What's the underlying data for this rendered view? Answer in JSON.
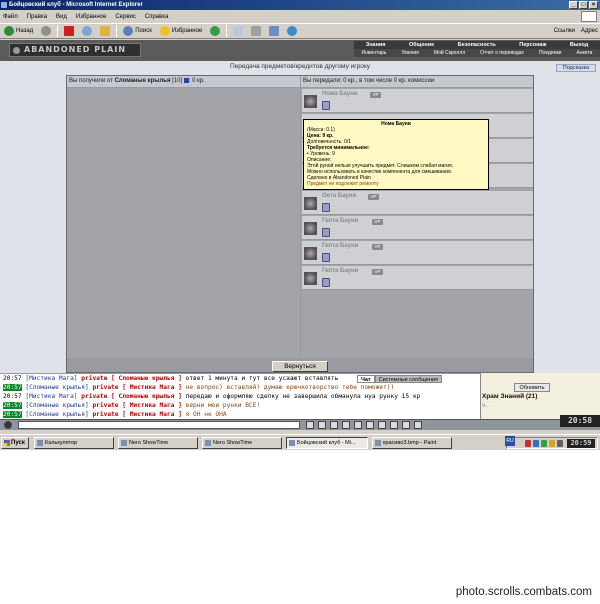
{
  "window": {
    "title": "Бойцовский клуб - Microsoft Internet Explorer"
  },
  "menu": [
    "Файл",
    "Правка",
    "Вид",
    "Избранное",
    "Сервис",
    "Справка"
  ],
  "toolbar": {
    "back": "Назад",
    "search": "Поиск",
    "favorites": "Избранное",
    "links": "Ссылки",
    "address": "Адрес"
  },
  "game": {
    "logo": "ABANDONED PLAIN",
    "nav_top": [
      "Знания",
      "Общение",
      "Безопасность",
      "Персонаж",
      "Выход"
    ],
    "nav_bottom": [
      "Инвентарь",
      "Умения",
      "Мой Скроллл",
      "Отчет о переводах",
      "Поединки",
      "Анкета"
    ],
    "help": "Подсказка",
    "page_title": "Передача предметов/кредитов другому игроку",
    "left_header_prefix": "Вы получили от ",
    "left_header_user": "Сломаные крылья",
    "left_header_level": " [10] ",
    "left_header_suffix": ": 0 кр.",
    "right_header": "Вы передали: 0 кр., в том числе 0 кр. комиссии",
    "return_button": "Вернуться",
    "badge": "VP",
    "items": [
      "Нома Бауни",
      "",
      "",
      "",
      "Оета Бауни",
      "Гепта Бауни",
      "Гепта Бауни",
      "Гепта Бауни"
    ]
  },
  "tooltip": {
    "title": "Нома Бауни",
    "mass": "(Масса: 0.1)",
    "price_label": "Цена:",
    "price": "9 кр.",
    "durability": "Долговечность: 0/1",
    "req_title": "Требуется минимальное:",
    "req_level": "• Уровень: 9",
    "desc_title": "Описание:",
    "desc1": "Этой руной нельзя улучшить предмет. Слишком слабая магия.",
    "desc2": "Можно использовать в качестве компонента для смешивания.",
    "made": "Сделано в Abandoned Plain",
    "repair": "Предмет не подлежит ремонту"
  },
  "chat": {
    "tabs": [
      "Чат",
      "Системные сообщения"
    ],
    "lines": [
      {
        "time": "20:57",
        "user": "[Мистика Мага]",
        "priv": "private [ Сломаные крылья ]",
        "text": "ответ 1 минута и тут все усаают вставлять",
        "hl": false,
        "brown": false
      },
      {
        "time": "20:57",
        "user": "[Сломаные крылья]",
        "priv": "private [ Мистика Мага ]",
        "text": "не вопрос) вставляй) думаю крючкотворство тебе поможет))",
        "hl": true,
        "brown": true
      },
      {
        "time": "20:57",
        "user": "[Мистика Мага]",
        "priv": "private [ Сломаные крылья ]",
        "text": "передаю и оформляю сделку не завершила обманула нуа рунку 15 кр",
        "hl": false,
        "brown": false
      },
      {
        "time": "20:57",
        "user": "[Сломаные крылья]",
        "priv": "private [ Мистика Мага ]",
        "text": "верни мои рунки ВСЕ!",
        "hl": true,
        "brown": true
      },
      {
        "time": "20:57",
        "user": "[Сломаные крылья]",
        "priv": "private [ Мистика Мага ]",
        "text": "я ОН не ОНА",
        "hl": true,
        "brown": true
      }
    ],
    "refresh": "Обновить",
    "room": "Храм Знаний (21)",
    "room_sub": "Ч...",
    "clock": "20:58"
  },
  "taskbar": {
    "start": "Пуск",
    "tasks": [
      "Калькулятор",
      "Nero ShowTime",
      "Nero ShowTime",
      "Бойцовский клуб - Mi...",
      "красивоЗ.bmp - Paint"
    ],
    "lang": "RU",
    "clock": "20:59"
  },
  "footer": "photo.scrolls.combats.com"
}
